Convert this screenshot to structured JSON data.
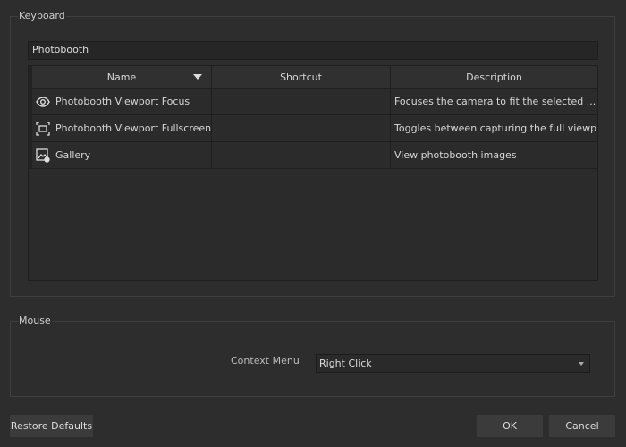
{
  "keyboard": {
    "title": "Keyboard",
    "filter": "Photobooth",
    "columns": {
      "name": "Name",
      "shortcut": "Shortcut",
      "description": "Description"
    },
    "rows": [
      {
        "icon": "eye-icon",
        "name": "Photobooth Viewport Focus",
        "shortcut": "",
        "description": "Focuses the camera to fit the selected ..."
      },
      {
        "icon": "fullscreen-icon",
        "name": "Photobooth Viewport Fullscreen",
        "shortcut": "",
        "description": "Toggles between capturing the full viewp..."
      },
      {
        "icon": "gallery-icon",
        "name": "Gallery",
        "shortcut": "",
        "description": "View photobooth images"
      }
    ]
  },
  "mouse": {
    "title": "Mouse",
    "context_menu_label": "Context Menu",
    "context_menu_value": "Right Click"
  },
  "buttons": {
    "restore": "Restore Defaults",
    "ok": "OK",
    "cancel": "Cancel"
  }
}
